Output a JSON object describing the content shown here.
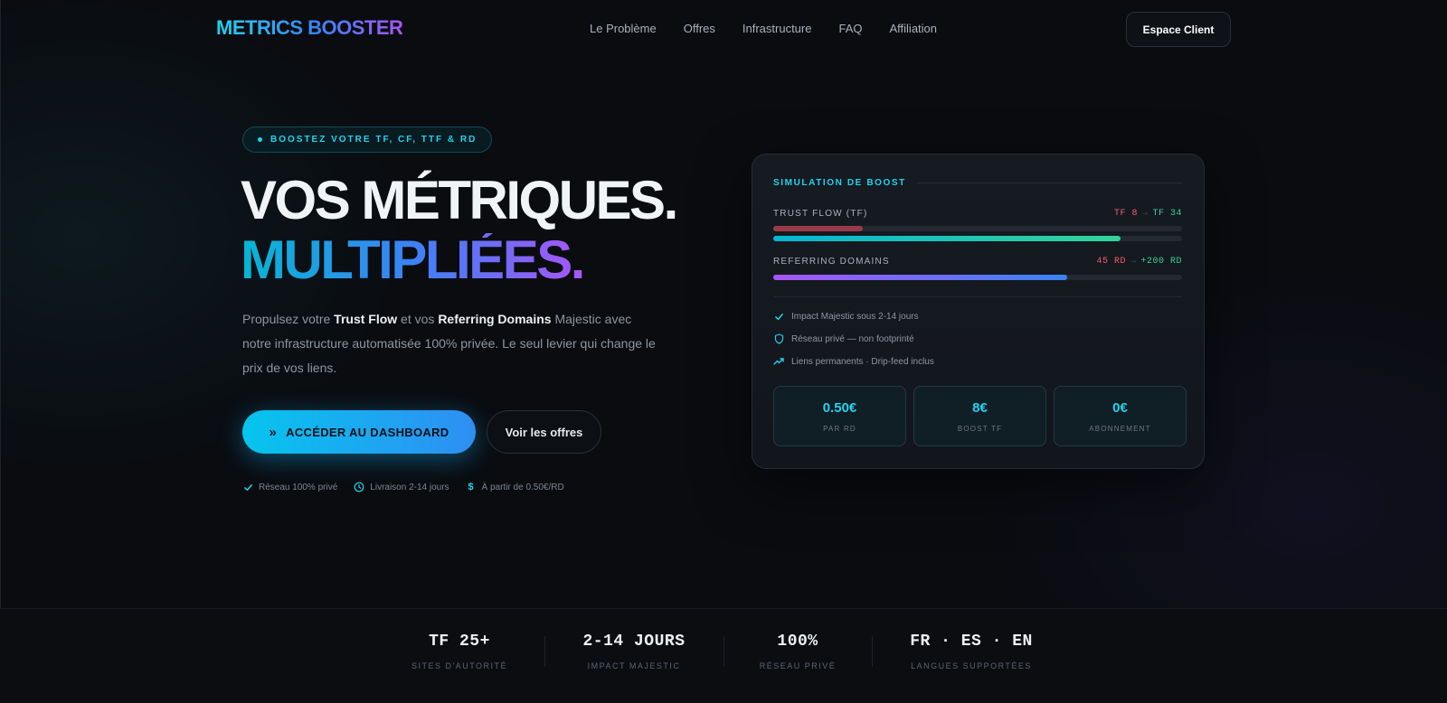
{
  "brand": {
    "logo": "METRICS BOOSTER"
  },
  "nav": {
    "links": [
      "Le Problème",
      "Offres",
      "Infrastructure",
      "FAQ",
      "Affiliation"
    ],
    "client_button": "Espace Client"
  },
  "hero": {
    "badge": "BOOSTEZ VOTRE TF, CF, TTF & RD",
    "title_line1": "VOS MÉTRIQUES.",
    "title_line2": "MULTIPLIÉES.",
    "lead": {
      "p1": "Propulsez votre ",
      "b1": "Trust Flow",
      "p2": " et vos ",
      "b2": "Referring Domains",
      "p3": " Majestic avec notre infrastructure automatisée 100% privée. Le seul levier qui change le prix de vos liens."
    },
    "cta_primary": "ACCÉDER AU DASHBOARD",
    "cta_secondary": "Voir les offres",
    "features": [
      {
        "icon": "check-icon",
        "label": "Réseau 100% privé"
      },
      {
        "icon": "clock-icon",
        "label": "Livraison 2-14 jours"
      },
      {
        "icon": "dollar-icon",
        "label": "À partir de 0.50€/RD"
      }
    ]
  },
  "simulation": {
    "title": "SIMULATION DE BOOST",
    "trust_flow": {
      "label": "TRUST FLOW (TF)",
      "from": "TF 8",
      "arrow": "→",
      "to": "TF 34",
      "before_fraction": 0.22,
      "after_fraction": 0.85
    },
    "referring_domains": {
      "label": "REFERRING DOMAINS",
      "from": "45 RD",
      "arrow": "→",
      "to": "+200 RD",
      "after_fraction": 0.72
    },
    "checks": [
      {
        "icon": "check-icon",
        "label": "Impact Majestic sous 2-14 jours"
      },
      {
        "icon": "shield-icon",
        "label": "Réseau privé — non footprinté"
      },
      {
        "icon": "trend-up-icon",
        "label": "Liens permanents · Drip-feed inclus"
      }
    ],
    "stats": [
      {
        "value": "0.50€",
        "label": "PAR RD"
      },
      {
        "value": "8€",
        "label": "BOOST TF"
      },
      {
        "value": "0€",
        "label": "ABONNEMENT"
      }
    ]
  },
  "bottom_stats": [
    {
      "value": "TF 25+",
      "label": "SITES D'AUTORITÉ"
    },
    {
      "value": "2-14 JOURS",
      "label": "IMPACT MAJESTIC"
    },
    {
      "value": "100%",
      "label": "RÉSEAU PRIVÉ"
    },
    {
      "value": "FR · ES · EN",
      "label": "LANGUES SUPPORTÉES"
    }
  ],
  "colors": {
    "accent": "#22d3ee",
    "background": "#0a0c10",
    "gradient_start": "#06b6d4",
    "gradient_end": "#a855f7",
    "red": "#f05d6a",
    "green": "#34d399"
  }
}
